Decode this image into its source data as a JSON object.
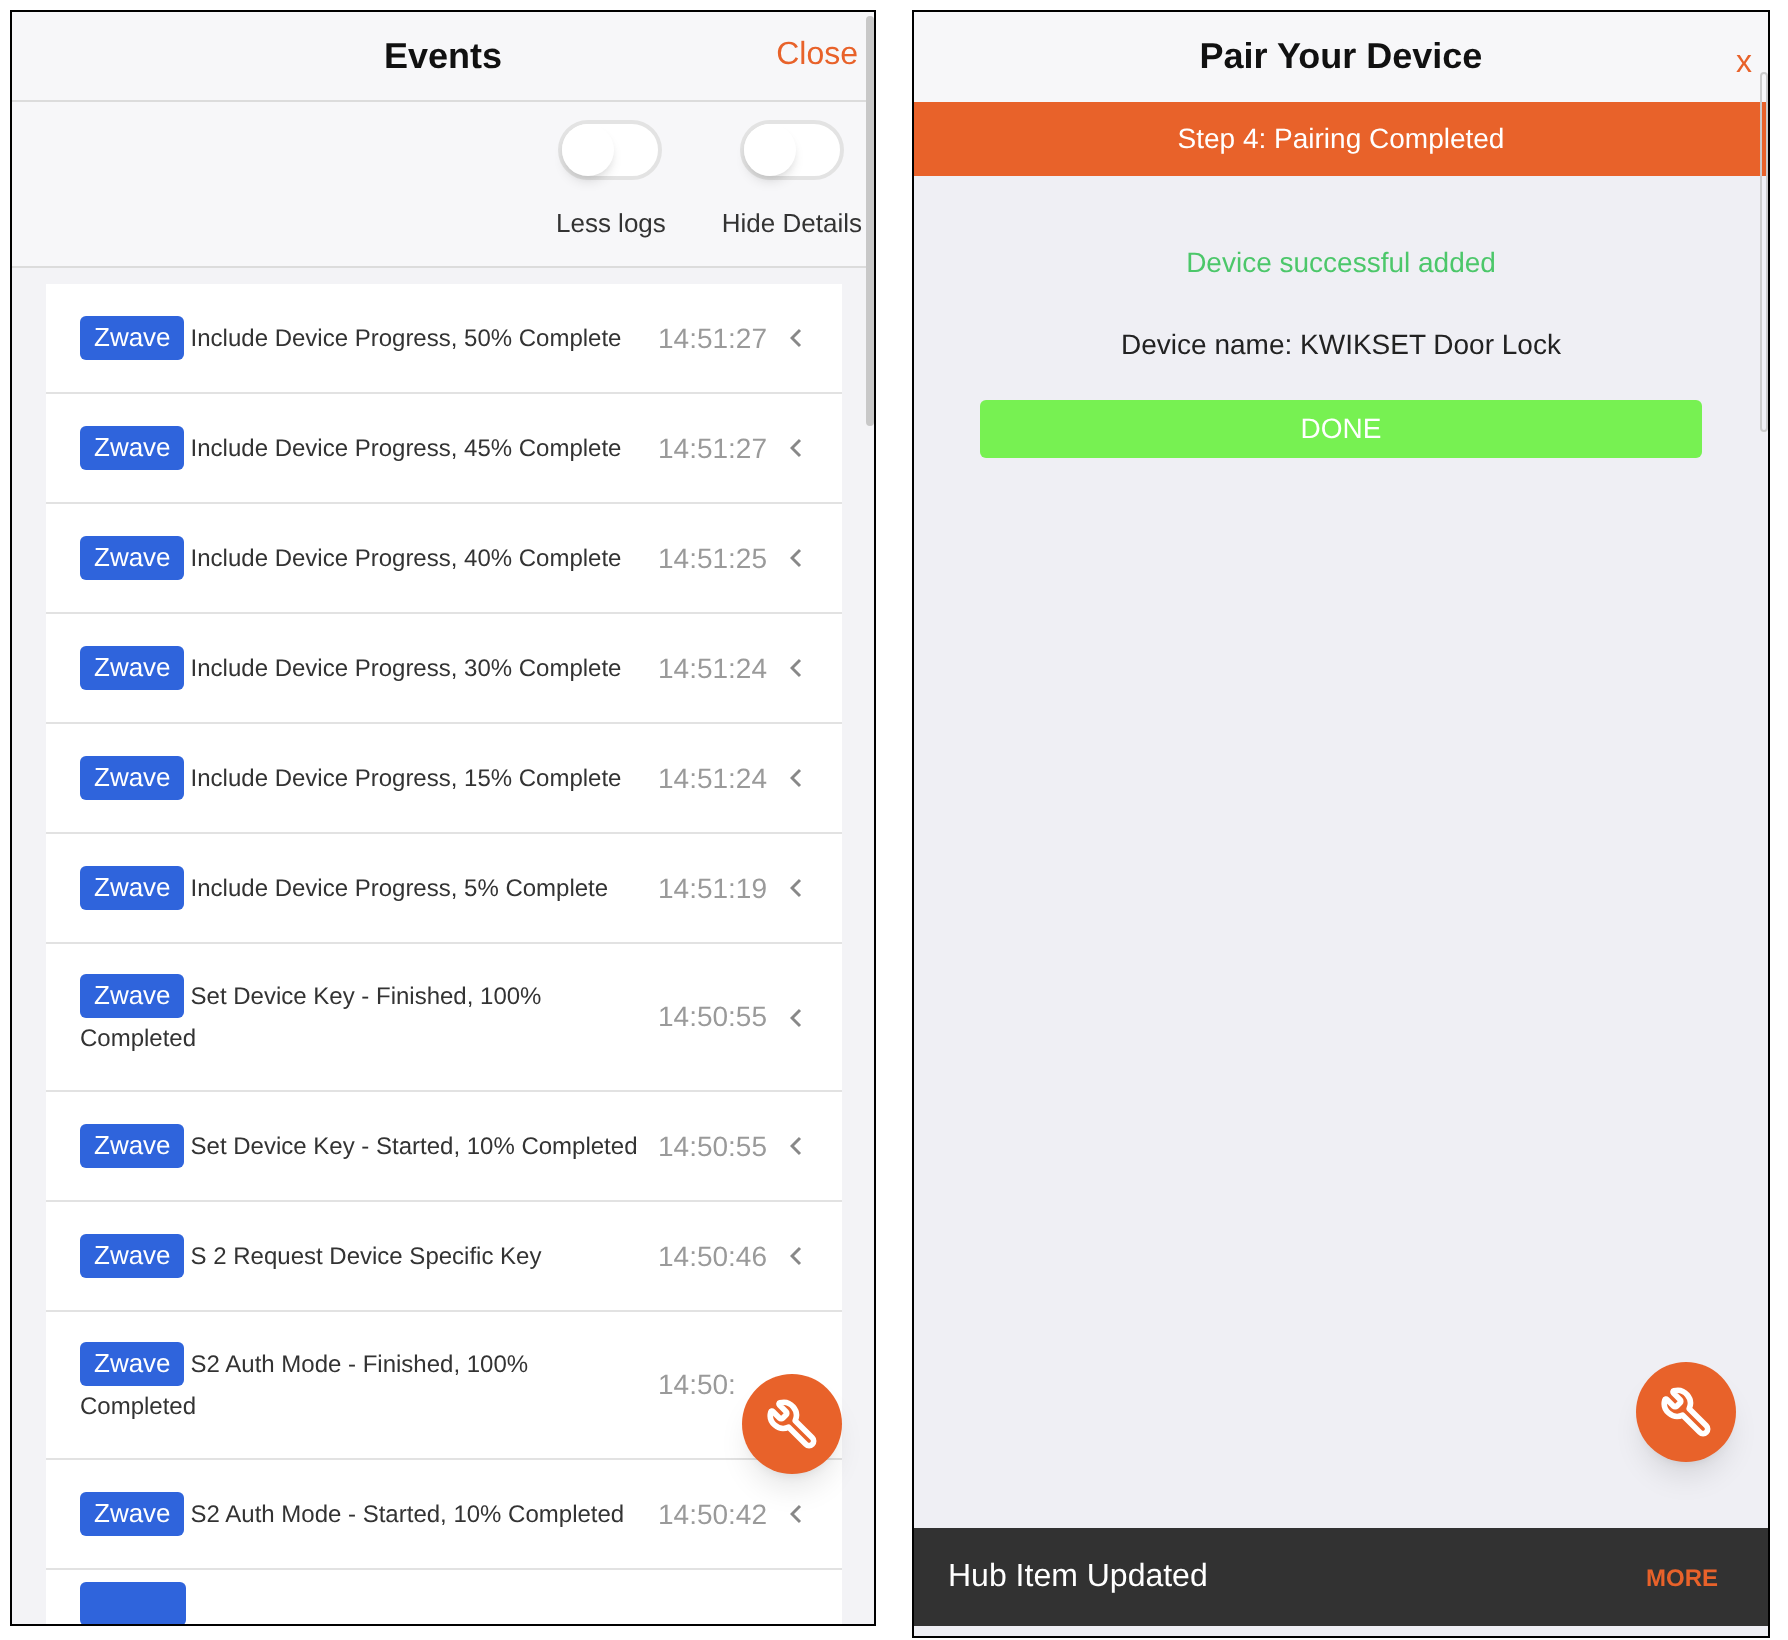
{
  "events_panel": {
    "title": "Events",
    "close": "Close",
    "toggles": [
      {
        "label": "Less logs",
        "on": false
      },
      {
        "label": "Hide Details",
        "on": false
      }
    ],
    "events": [
      {
        "tag": "Zwave",
        "message": "Include Device Progress, 50% Complete",
        "time": "14:51:27",
        "chevron": true
      },
      {
        "tag": "Zwave",
        "message": "Include Device Progress, 45% Complete",
        "time": "14:51:27",
        "chevron": true
      },
      {
        "tag": "Zwave",
        "message": "Include Device Progress, 40% Complete",
        "time": "14:51:25",
        "chevron": true
      },
      {
        "tag": "Zwave",
        "message": "Include Device Progress, 30% Complete",
        "time": "14:51:24",
        "chevron": true
      },
      {
        "tag": "Zwave",
        "message": "Include Device Progress, 15% Complete",
        "time": "14:51:24",
        "chevron": true
      },
      {
        "tag": "Zwave",
        "message": "Include Device Progress, 5% Complete",
        "time": "14:51:19",
        "chevron": true
      },
      {
        "tag": "Zwave",
        "message": "Set Device Key - Finished, 100%",
        "message_continued": "Completed",
        "time": "14:50:55",
        "chevron": true
      },
      {
        "tag": "Zwave",
        "message": "Set Device Key - Started, 10% Completed",
        "time": "14:50:55",
        "chevron": true
      },
      {
        "tag": "Zwave",
        "message": "S 2 Request Device Specific Key",
        "time": "14:50:46",
        "chevron": true
      },
      {
        "tag": "Zwave",
        "message": "S2 Auth Mode - Finished, 100%",
        "message_continued": "Completed",
        "time": "14:50:",
        "chevron": false
      },
      {
        "tag": "Zwave",
        "message": "S2 Auth Mode - Started, 10% Completed",
        "time": "14:50:42",
        "chevron": true
      }
    ]
  },
  "pair_panel": {
    "title": "Pair Your Device",
    "close": "x",
    "step": "Step 4: Pairing Completed",
    "status": "Device successful added",
    "device_name": "Device name: KWIKSET Door Lock",
    "done_button": "DONE",
    "snackbar": {
      "message": "Hub Item Updated",
      "action": "MORE"
    }
  }
}
